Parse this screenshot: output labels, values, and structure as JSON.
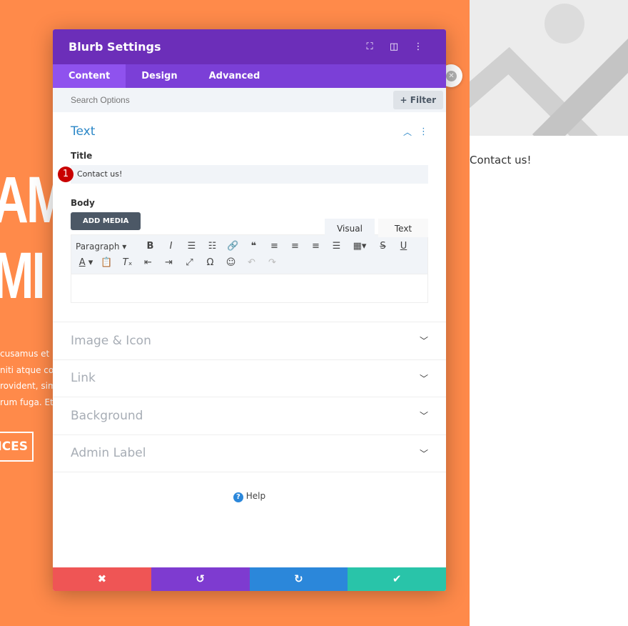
{
  "background": {
    "headline_lines": [
      "AM",
      "MI"
    ],
    "paragraph_lines": [
      "cusamus et iu",
      "niti atque cor",
      "rovident, sim",
      "rum fuga. Et h"
    ],
    "button_label": "ICES",
    "accent": "#ff8a4a"
  },
  "preview": {
    "blurb_title": "Contact us!"
  },
  "modal": {
    "title": "Blurb Settings",
    "tabs": [
      {
        "label": "Content",
        "active": true
      },
      {
        "label": "Design"
      },
      {
        "label": "Advanced"
      }
    ],
    "search_placeholder": "Search Options",
    "filter_label": "Filter",
    "text_section": {
      "title": "Text",
      "title_label": "Title",
      "title_value": "Contact us!",
      "badge": "1",
      "body_label": "Body",
      "add_media": "ADD MEDIA",
      "editor_tabs": [
        "Visual",
        "Text"
      ],
      "format_select": "Paragraph"
    },
    "sections": [
      "Image & Icon",
      "Link",
      "Background",
      "Admin Label"
    ],
    "help": "Help",
    "colors": {
      "header": "#6c2eb9",
      "tabs": "#7b3fd7",
      "cancel": "#ef5555",
      "undo": "#7e3bd0",
      "redo": "#2b87da",
      "save": "#29c4a9"
    }
  }
}
